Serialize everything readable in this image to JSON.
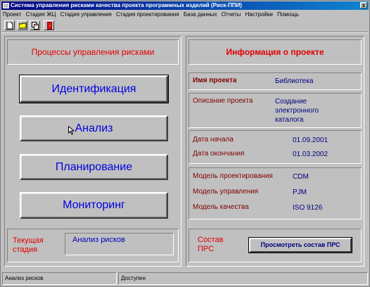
{
  "window": {
    "title": "Система управления рисками качества проекта программных изделий (Риск-ППИ)",
    "close_glyph": "x"
  },
  "menu": [
    "Проект",
    "Стадия ЖЦ",
    "Стадия управления",
    "Стадия проектирования",
    "База данных",
    "Отчеты",
    "Настройки",
    "Помощь"
  ],
  "toolbar": {
    "buttons": [
      "new-document-icon",
      "open-folder-icon",
      "copy-icon",
      "exit-door-icon"
    ]
  },
  "left": {
    "heading": "Процессы управления рисками",
    "buttons": [
      "Идентификация",
      "Анализ",
      "Планирование",
      "Мониторинг"
    ],
    "stage_label": "Текущая стадия",
    "stage_value": "Анализ рисков"
  },
  "right": {
    "heading": "Информация о проекте",
    "project_name_label": "Имя проекта",
    "project_name_value": "Библиотека",
    "description_label": "Описание проекта",
    "description_value": "Создание электронного каталога",
    "start_label": "Дата начала",
    "start_value": "01.09.2001",
    "end_label": "Дата окончания",
    "end_value": "01.03.2002",
    "design_model_label": "Модель проектирования",
    "design_model_value": "CDM",
    "mgmt_model_label": "Модель управления",
    "mgmt_model_value": "PJM",
    "quality_model_label": "Модель качества",
    "quality_model_value": "ISO 9126",
    "composition_label": "Состав ПРС",
    "composition_button": "Просмотреть состав ПРС"
  },
  "status": {
    "left": "Анализ рисков",
    "middle": "Доступен"
  },
  "colors": {
    "titlebar": "#000080",
    "heading": "#e00000",
    "button_text": "#0000e0",
    "label": "#800000",
    "value": "#000080"
  }
}
